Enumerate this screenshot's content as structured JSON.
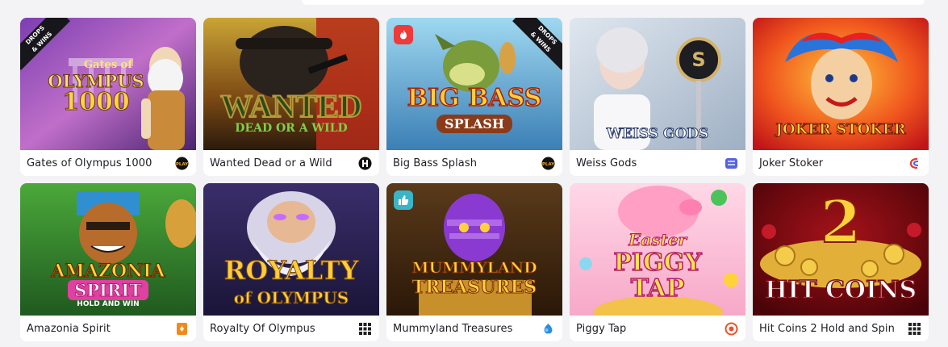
{
  "games": [
    {
      "name": "Gates of Olympus 1000",
      "art_title": "Gates of",
      "art_title2": "OLYMPUS",
      "art_title3": "1000",
      "badge": "DROPS & WINS",
      "provider_icon": "pragmatic-play-icon"
    },
    {
      "name": "Wanted Dead or a Wild",
      "art_title": "WANTED",
      "art_title2": "DEAD OR A WILD",
      "provider_icon": "hacksaw-icon"
    },
    {
      "name": "Big Bass Splash",
      "art_title": "BIG BASS",
      "art_title2": "SPLASH",
      "badge": "DROPS & WINS",
      "hot_icon": "fire-icon",
      "provider_icon": "pragmatic-play-icon"
    },
    {
      "name": "Weiss Gods",
      "art_title": "WEISS GODS",
      "provider_icon": "layers-provider-icon"
    },
    {
      "name": "Joker Stoker",
      "art_title": "JOKER STOKER",
      "provider_icon": "endorphina-icon"
    },
    {
      "name": "Amazonia Spirit",
      "art_title": "AMAZONIA",
      "art_title2": "SPIRIT",
      "art_title3": "HOLD AND WIN",
      "provider_icon": "card-provider-icon"
    },
    {
      "name": "Royalty Of Olympus",
      "art_title": "ROYALTY",
      "art_title2": "of OLYMPUS",
      "provider_icon": "grid-provider-icon"
    },
    {
      "name": "Mummyland Treasures",
      "art_title": "MUMMYLAND",
      "art_title2": "TREASURES",
      "like_icon": "thumbs-up-icon",
      "provider_icon": "belatra-icon"
    },
    {
      "name": "Piggy Tap",
      "art_title": "Easter",
      "art_title2": "PIGGY",
      "art_title3": "TAP",
      "provider_icon": "target-provider-icon"
    },
    {
      "name": "Hit Coins 2 Hold and Spin",
      "art_title": "2",
      "art_title2": "HIT COINS",
      "provider_icon": "grid-provider-icon"
    }
  ],
  "colors": {
    "background": "#f3f3f5",
    "card": "#ffffff",
    "text": "#1d1d24",
    "hot": "#ee3a3a",
    "like": "#3cb4c8"
  }
}
